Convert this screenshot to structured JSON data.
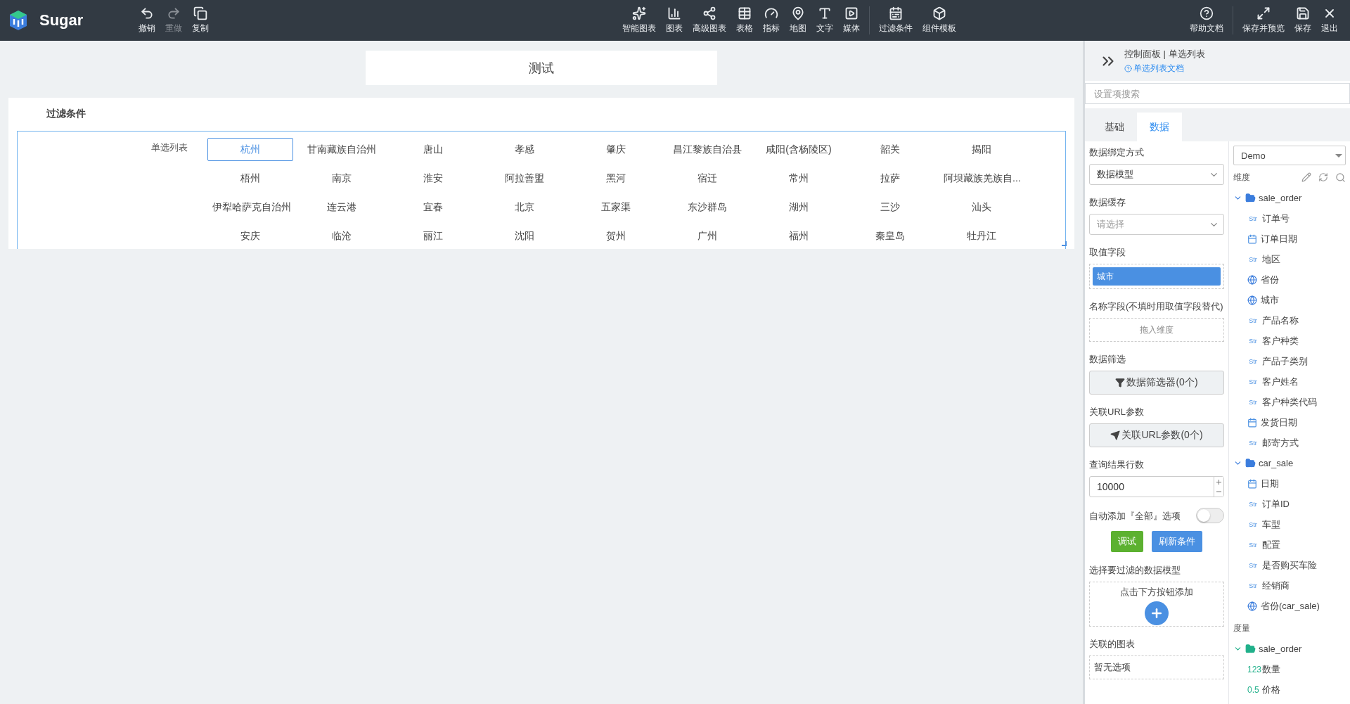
{
  "app": {
    "name": "Sugar"
  },
  "toolbar": {
    "left": [
      {
        "label": "撤销",
        "disabled": false
      },
      {
        "label": "重做",
        "disabled": true
      },
      {
        "label": "复制",
        "disabled": false
      }
    ],
    "center": [
      {
        "label": "智能图表"
      },
      {
        "label": "图表"
      },
      {
        "label": "高级图表"
      },
      {
        "label": "表格"
      },
      {
        "label": "指标"
      },
      {
        "label": "地图"
      },
      {
        "label": "文字"
      },
      {
        "label": "媒体"
      }
    ],
    "center_extra": [
      {
        "label": "过滤条件"
      },
      {
        "label": "组件模板"
      }
    ],
    "help": {
      "label": "帮助文档"
    },
    "right": [
      {
        "label": "保存并预览"
      },
      {
        "label": "保存"
      },
      {
        "label": "退出"
      }
    ]
  },
  "canvas": {
    "title": "测试",
    "filter": {
      "title": "过滤条件",
      "label": "单选列表",
      "options": [
        {
          "label": "杭州",
          "selected": true
        },
        {
          "label": "甘南藏族自治州",
          "selected": false
        },
        {
          "label": "唐山",
          "selected": false
        },
        {
          "label": "孝感",
          "selected": false
        },
        {
          "label": "肇庆",
          "selected": false
        },
        {
          "label": "昌江黎族自治县",
          "selected": false
        },
        {
          "label": "咸阳(含杨陵区)",
          "selected": false
        },
        {
          "label": "韶关",
          "selected": false
        },
        {
          "label": "揭阳",
          "selected": false
        },
        {
          "label": "梧州",
          "selected": false
        },
        {
          "label": "南京",
          "selected": false
        },
        {
          "label": "淮安",
          "selected": false
        },
        {
          "label": "阿拉善盟",
          "selected": false
        },
        {
          "label": "黑河",
          "selected": false
        },
        {
          "label": "宿迁",
          "selected": false
        },
        {
          "label": "常州",
          "selected": false
        },
        {
          "label": "拉萨",
          "selected": false
        },
        {
          "label": "阿坝藏族羌族自...",
          "selected": false
        },
        {
          "label": "伊犁哈萨克自治州",
          "selected": false
        },
        {
          "label": "连云港",
          "selected": false
        },
        {
          "label": "宜春",
          "selected": false
        },
        {
          "label": "北京",
          "selected": false
        },
        {
          "label": "五家渠",
          "selected": false
        },
        {
          "label": "东沙群岛",
          "selected": false
        },
        {
          "label": "湖州",
          "selected": false
        },
        {
          "label": "三沙",
          "selected": false
        },
        {
          "label": "汕头",
          "selected": false
        },
        {
          "label": "安庆",
          "selected": false
        },
        {
          "label": "临沧",
          "selected": false
        },
        {
          "label": "丽江",
          "selected": false
        },
        {
          "label": "沈阳",
          "selected": false
        },
        {
          "label": "贺州",
          "selected": false
        },
        {
          "label": "广州",
          "selected": false
        },
        {
          "label": "福州",
          "selected": false
        },
        {
          "label": "秦皇岛",
          "selected": false
        },
        {
          "label": "牡丹江",
          "selected": false
        }
      ]
    }
  },
  "panel": {
    "title": "控制面板 | 单选列表",
    "doc_link": "单选列表文档",
    "search": {
      "placeholder": "设置项搜索"
    },
    "tabs": [
      {
        "label": "基础",
        "selected": false
      },
      {
        "label": "数据",
        "selected": true
      }
    ],
    "settings": [
      {
        "kind": "select",
        "label": "数据绑定方式",
        "value": "数据模型"
      },
      {
        "kind": "select",
        "label": "数据缓存",
        "placeholder": "请选择"
      },
      {
        "kind": "field",
        "label": "取值字段",
        "value": "城市"
      },
      {
        "kind": "drop",
        "label": "名称字段(不填时用取值字段替代)",
        "placeholder": "拖入维度"
      },
      {
        "kind": "button",
        "label": "数据筛选",
        "button": "数据筛选器(0个)"
      },
      {
        "kind": "button",
        "label": "关联URL参数",
        "button": "关联URL参数(0个)"
      },
      {
        "kind": "number",
        "label": "查询结果行数",
        "value": "10000"
      },
      {
        "kind": "toggle",
        "label": "自动添加『全部』选项",
        "on": false
      },
      {
        "kind": "actions",
        "buttons": [
          {
            "label": "调试",
            "color": "#5cb130"
          },
          {
            "label": "刷新条件",
            "color": "#4a90e2"
          }
        ]
      },
      {
        "kind": "add",
        "label": "选择要过滤的数据模型",
        "text": "点击下方按钮添加"
      },
      {
        "kind": "list",
        "label": "关联的图表",
        "text": "暂无选项"
      }
    ],
    "dataset": {
      "value": "Demo"
    },
    "dimensions": {
      "title": "维度",
      "groups": [
        {
          "name": "sale_order",
          "expanded": true,
          "children": [
            {
              "kind": "text",
              "tag": "Str",
              "name": "订单号"
            },
            {
              "kind": "date",
              "name": "订单日期"
            },
            {
              "kind": "text",
              "tag": "Str",
              "name": "地区"
            },
            {
              "kind": "geo",
              "name": "省份"
            },
            {
              "kind": "geo",
              "name": "城市"
            },
            {
              "kind": "text",
              "tag": "Str",
              "name": "产品名称"
            },
            {
              "kind": "text",
              "tag": "Str",
              "name": "客户种类"
            },
            {
              "kind": "text",
              "tag": "Str",
              "name": "产品子类别"
            },
            {
              "kind": "text",
              "tag": "Str",
              "name": "客户姓名"
            },
            {
              "kind": "text",
              "tag": "Str",
              "name": "客户种类代码"
            },
            {
              "kind": "date",
              "name": "发货日期"
            },
            {
              "kind": "text",
              "tag": "Str",
              "name": "邮寄方式"
            }
          ]
        },
        {
          "name": "car_sale",
          "expanded": true,
          "children": [
            {
              "kind": "date",
              "name": "日期"
            },
            {
              "kind": "text",
              "tag": "Str",
              "name": "订单ID"
            },
            {
              "kind": "text",
              "tag": "Str",
              "name": "车型"
            },
            {
              "kind": "text",
              "tag": "Str",
              "name": "配置"
            },
            {
              "kind": "text",
              "tag": "Str",
              "name": "是否购买车险"
            },
            {
              "kind": "text",
              "tag": "Str",
              "name": "经销商"
            },
            {
              "kind": "geo",
              "name": "省份(car_sale)"
            }
          ]
        }
      ]
    },
    "measures": {
      "title": "度量",
      "groups": [
        {
          "name": "sale_order",
          "expanded": true,
          "children": [
            {
              "kind": "text",
              "tag": "123",
              "name": "数量"
            },
            {
              "kind": "text",
              "tag": "0.5",
              "name": "价格"
            }
          ]
        }
      ]
    }
  }
}
